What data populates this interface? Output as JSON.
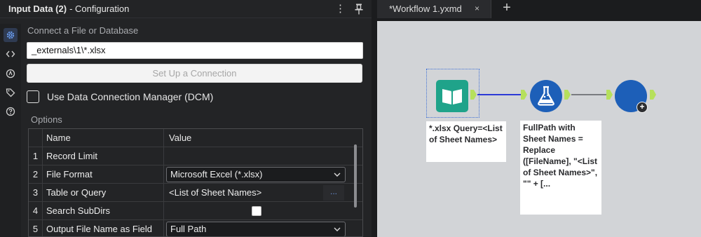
{
  "config_panel": {
    "title": "Input Data (2)",
    "subtitle": "- Configuration",
    "menu_icon": "⋮",
    "pin_icon": "pin-icon",
    "connect_label": "Connect a File or Database",
    "path_value": "_externals\\1\\*.xlsx",
    "setup_button": "Set Up a Connection",
    "dcm_label": "Use Data Connection Manager (DCM)",
    "dcm_checked": false,
    "options_label": "Options",
    "rail_icons": [
      "gear-icon",
      "code-icon",
      "tool-icon",
      "tag-icon",
      "help-icon"
    ],
    "grid": {
      "headers": [
        "Name",
        "Value"
      ],
      "rows": [
        {
          "num": "1",
          "name": "Record Limit",
          "value": ""
        },
        {
          "num": "2",
          "name": "File Format",
          "value": "Microsoft Excel (*.xlsx)"
        },
        {
          "num": "3",
          "name": "Table or Query",
          "value": "<List of Sheet Names>",
          "button": "..."
        },
        {
          "num": "4",
          "name": "Search SubDirs",
          "checked": false
        },
        {
          "num": "5",
          "name": "Output File Name as Field",
          "value": "Full Path"
        }
      ]
    }
  },
  "workflow": {
    "tab_label": "*Workflow 1.yxmd",
    "tab_close": "×",
    "add_tab": "+",
    "input_annotation": "*.xlsx Query=<List of Sheet Names>",
    "formula_annotation": "FullPath with Sheet Names = Replace ([FileName], \"<List of Sheet Names>\", \"\" + [...",
    "colors": {
      "input_tool": "#1fa38a",
      "formula_tool": "#1d5fb8",
      "anchor": "#b6e05c",
      "selected_connection": "#2c3ad6",
      "connection": "#7a7c80"
    }
  }
}
